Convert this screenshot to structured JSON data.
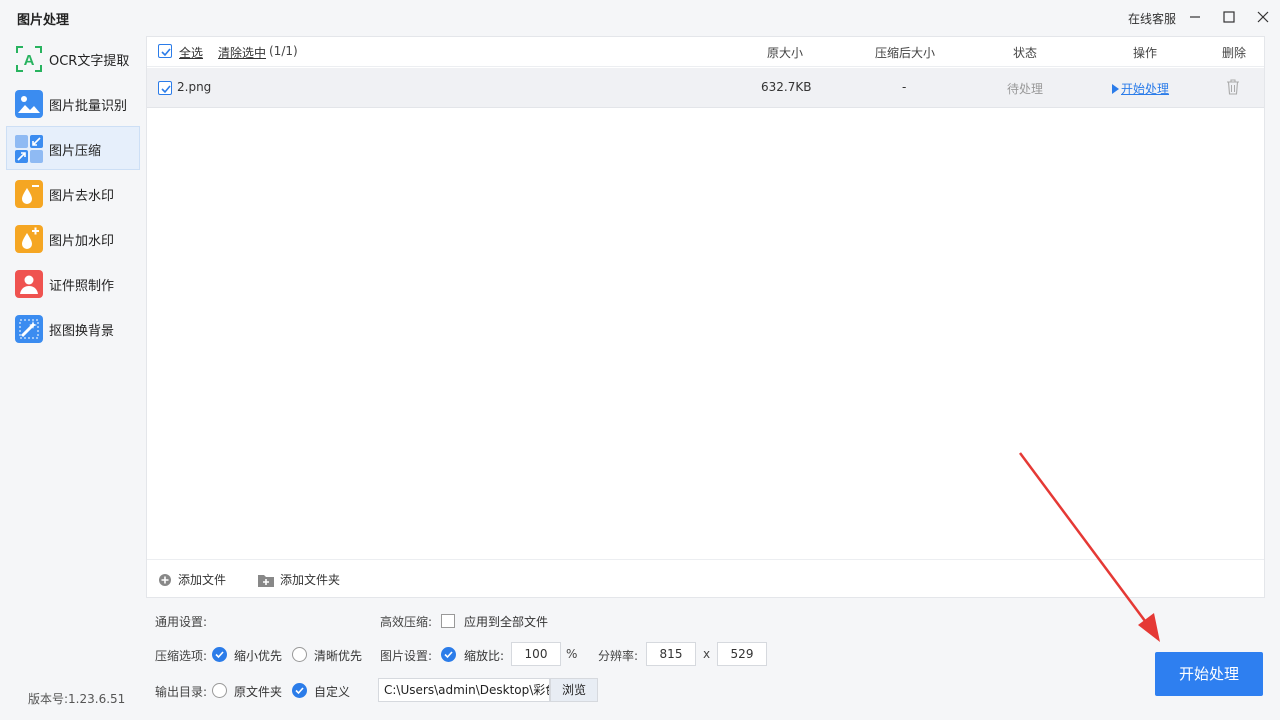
{
  "app": {
    "title": "图片处理",
    "support": "在线客服",
    "version": "版本号:1.23.6.51"
  },
  "sidebar": {
    "items": [
      {
        "label": "OCR文字提取",
        "icon": "ocr-text-icon",
        "color": "#28b35f"
      },
      {
        "label": "图片批量识别",
        "icon": "image-recognize-icon",
        "color": "#3b8cf0"
      },
      {
        "label": "图片压缩",
        "icon": "image-compress-icon",
        "color": "#3b8cf0",
        "active": true
      },
      {
        "label": "图片去水印",
        "icon": "remove-watermark-icon",
        "color": "#f5a623"
      },
      {
        "label": "图片加水印",
        "icon": "add-watermark-icon",
        "color": "#f5a623"
      },
      {
        "label": "证件照制作",
        "icon": "id-photo-icon",
        "color": "#ef5350"
      },
      {
        "label": "抠图换背景",
        "icon": "cutout-background-icon",
        "color": "#3b8cf0"
      }
    ]
  },
  "table": {
    "select_all": "全选",
    "clear_selected": "清除选中",
    "count": "(1/1)",
    "headers": {
      "original_size": "原大小",
      "compressed_size": "压缩后大小",
      "status": "状态",
      "action": "操作",
      "delete": "删除"
    },
    "rows": [
      {
        "name": "2.png",
        "original_size": "632.7KB",
        "compressed_size": "-",
        "status": "待处理",
        "action": "开始处理",
        "checked": true
      }
    ]
  },
  "footer": {
    "add_file": "添加文件",
    "add_folder": "添加文件夹"
  },
  "settings": {
    "general_label": "通用设置:",
    "efficient_label": "高效压缩:",
    "apply_all": "应用到全部文件",
    "compress_label": "压缩选项:",
    "opt_small": "缩小优先",
    "opt_clear": "清晰优先",
    "image_label": "图片设置:",
    "scale_label": "缩放比:",
    "scale_value": "100",
    "percent": "%",
    "resolution_label": "分辨率:",
    "width": "815",
    "x_sep": "x",
    "height": "529",
    "output_label": "输出目录:",
    "out_original": "原文件夹",
    "out_custom": "自定义",
    "path": "C:\\Users\\admin\\Desktop\\彩色",
    "browse": "浏览"
  },
  "start_button": "开始处理",
  "colors": {
    "accent": "#2e7ff0",
    "annotation_arrow": "#e53935"
  }
}
